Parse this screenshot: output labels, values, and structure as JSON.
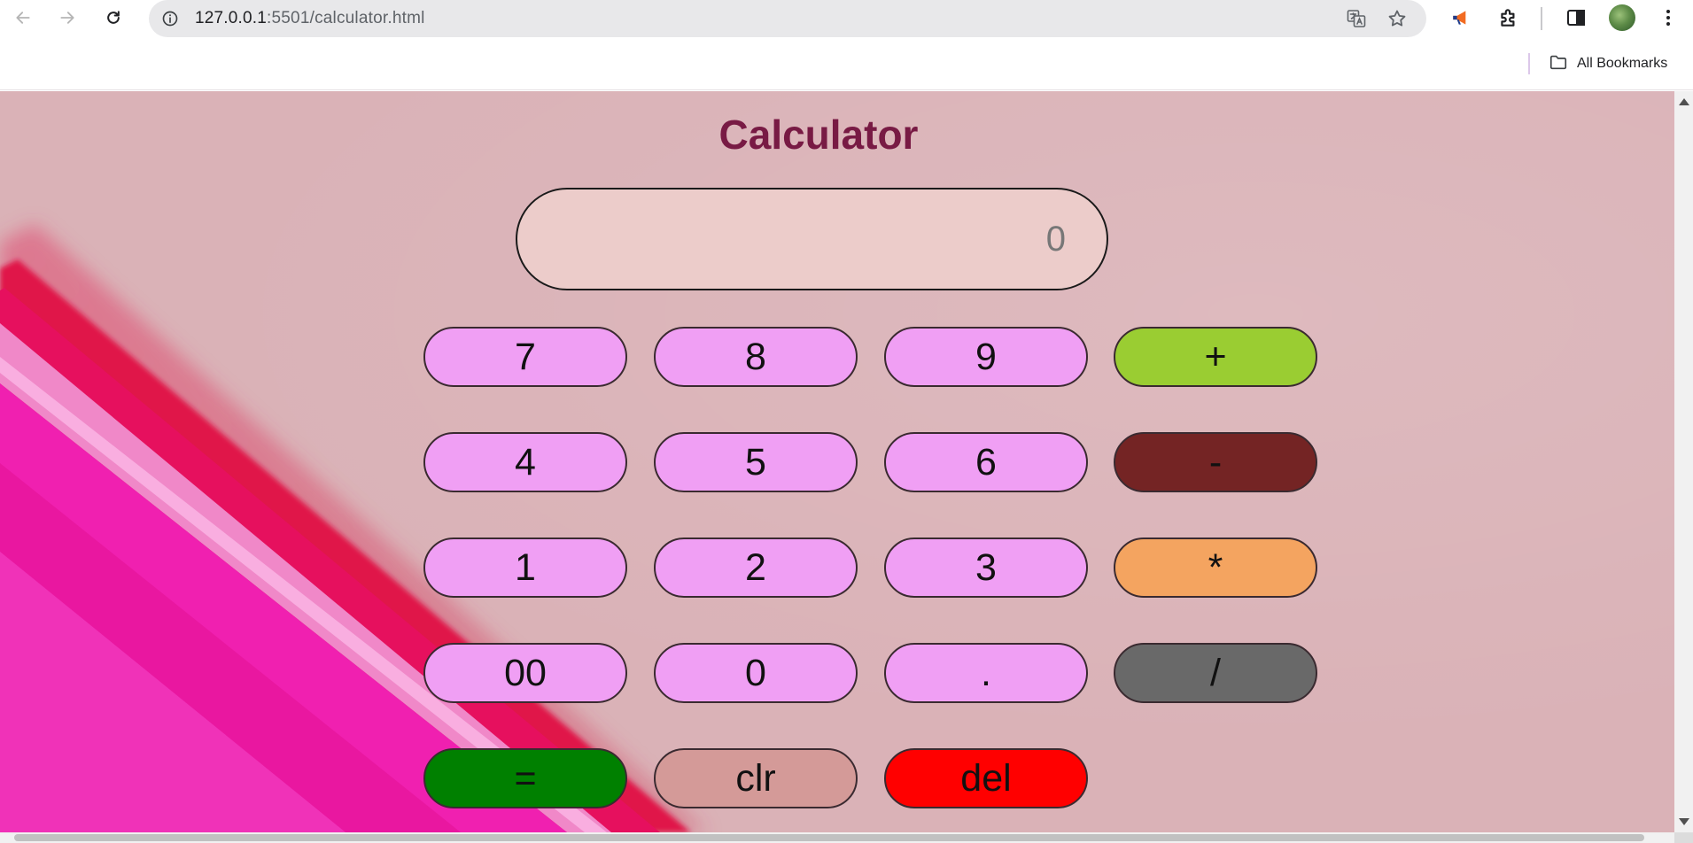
{
  "browser": {
    "url_host": "127.0.0.1",
    "url_rest": ":5501/calculator.html",
    "bookmarks_label": "All Bookmarks",
    "icons": [
      "back-icon",
      "forward-icon",
      "reload-icon",
      "site-info-icon",
      "translate-icon",
      "star-icon",
      "megaphone-icon",
      "extensions-icon",
      "side-panel-icon",
      "profile-avatar",
      "menu-icon",
      "folder-icon"
    ]
  },
  "calculator": {
    "title": "Calculator",
    "display_value": "0",
    "keys": [
      {
        "label": "7",
        "color": "#f09ff4"
      },
      {
        "label": "8",
        "color": "#f09ff4"
      },
      {
        "label": "9",
        "color": "#f09ff4"
      },
      {
        "label": "+",
        "color": "#9acd32"
      },
      {
        "label": "4",
        "color": "#f09ff4"
      },
      {
        "label": "5",
        "color": "#f09ff4"
      },
      {
        "label": "6",
        "color": "#f09ff4"
      },
      {
        "label": "-",
        "color": "#742424"
      },
      {
        "label": "1",
        "color": "#f09ff4"
      },
      {
        "label": "2",
        "color": "#f09ff4"
      },
      {
        "label": "3",
        "color": "#f09ff4"
      },
      {
        "label": "*",
        "color": "#f4a460"
      },
      {
        "label": "00",
        "color": "#f09ff4"
      },
      {
        "label": "0",
        "color": "#f09ff4"
      },
      {
        "label": ".",
        "color": "#f09ff4"
      },
      {
        "label": "/",
        "color": "#696969"
      },
      {
        "label": "=",
        "color": "#008000"
      },
      {
        "label": "clr",
        "color": "#d49a98"
      },
      {
        "label": "del",
        "color": "#ff0000"
      }
    ],
    "title_color": "#781a44",
    "display_bg": "#ecccca"
  }
}
